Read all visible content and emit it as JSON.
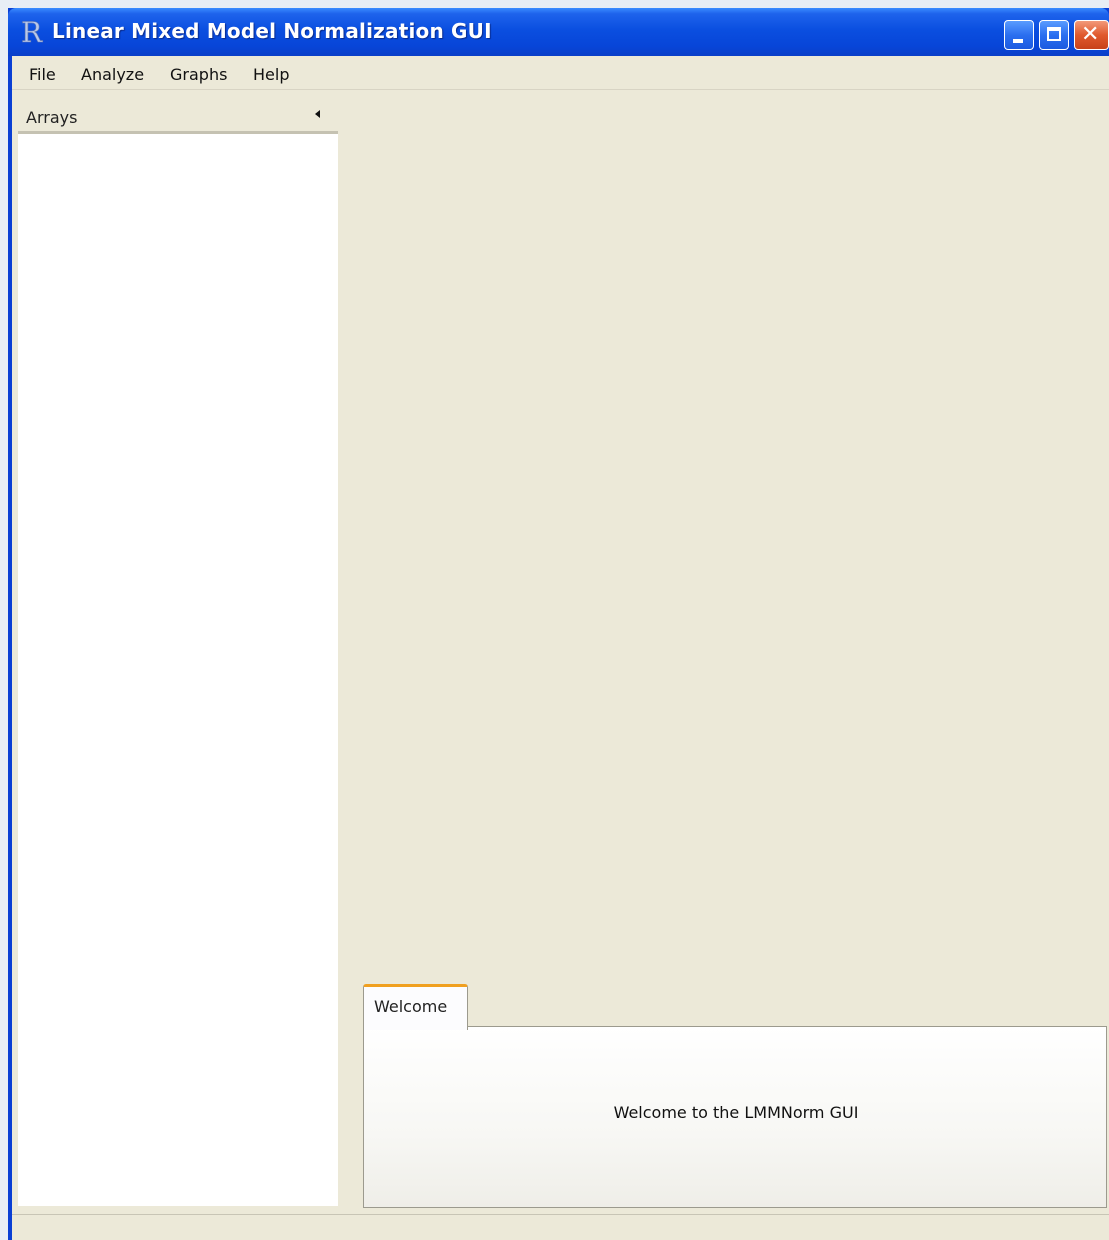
{
  "window": {
    "title": "Linear Mixed Model Normalization GUI",
    "icon": "r-logo-icon"
  },
  "menubar": {
    "items": [
      {
        "label": "File"
      },
      {
        "label": "Analyze"
      },
      {
        "label": "Graphs"
      },
      {
        "label": "Help"
      }
    ]
  },
  "arrays_panel": {
    "title": "Arrays",
    "collapse_icon": "triangle-left-icon"
  },
  "tabs": [
    {
      "label": "Welcome",
      "selected": true
    }
  ],
  "welcome": {
    "message": "Welcome to the LMMNorm GUI"
  },
  "colors": {
    "titlebar": "#0b4fe0",
    "background": "#ece9d8",
    "tab_accent": "#f0a020",
    "close_button": "#e05a2e"
  }
}
